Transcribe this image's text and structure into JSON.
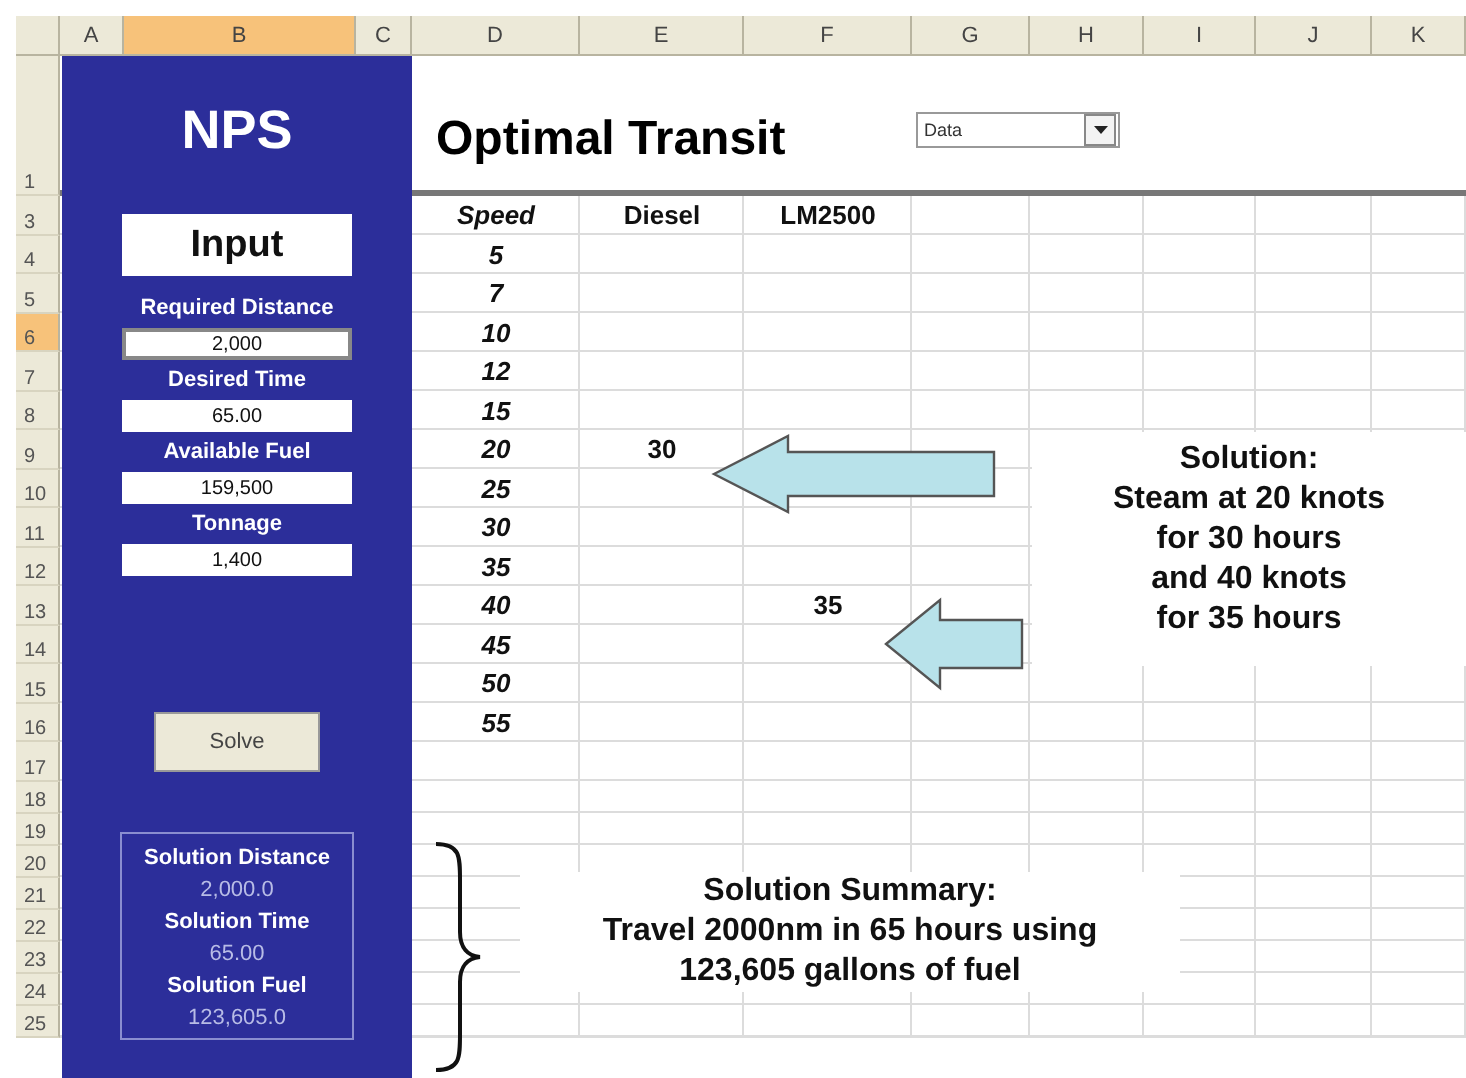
{
  "sheet": {
    "column_headers": [
      {
        "label": "A",
        "selected": false
      },
      {
        "label": "B",
        "selected": true
      },
      {
        "label": "C",
        "selected": false
      },
      {
        "label": "D",
        "selected": false
      },
      {
        "label": "E",
        "selected": false
      },
      {
        "label": "F",
        "selected": false
      },
      {
        "label": "G",
        "selected": false
      },
      {
        "label": "H",
        "selected": false
      },
      {
        "label": "I",
        "selected": false
      },
      {
        "label": "J",
        "selected": false
      },
      {
        "label": "K",
        "selected": false
      }
    ],
    "row_headers": [
      {
        "label": "1",
        "selected": false
      },
      {
        "label": "3",
        "selected": false
      },
      {
        "label": "4",
        "selected": false
      },
      {
        "label": "5",
        "selected": false
      },
      {
        "label": "6",
        "selected": true
      },
      {
        "label": "7",
        "selected": false
      },
      {
        "label": "8",
        "selected": false
      },
      {
        "label": "9",
        "selected": false
      },
      {
        "label": "10",
        "selected": false
      },
      {
        "label": "11",
        "selected": false
      },
      {
        "label": "12",
        "selected": false
      },
      {
        "label": "13",
        "selected": false
      },
      {
        "label": "14",
        "selected": false
      },
      {
        "label": "15",
        "selected": false
      },
      {
        "label": "16",
        "selected": false
      },
      {
        "label": "17",
        "selected": false
      },
      {
        "label": "18",
        "selected": false
      },
      {
        "label": "19",
        "selected": false
      },
      {
        "label": "20",
        "selected": false
      },
      {
        "label": "21",
        "selected": false
      },
      {
        "label": "22",
        "selected": false
      },
      {
        "label": "23",
        "selected": false
      },
      {
        "label": "24",
        "selected": false
      },
      {
        "label": "25",
        "selected": false
      }
    ]
  },
  "panel": {
    "title": "NPS",
    "section_label": "Input",
    "inputs": [
      {
        "label": "Required Distance",
        "value": "2,000",
        "selected": true
      },
      {
        "label": "Desired Time",
        "value": "65.00",
        "selected": false
      },
      {
        "label": "Available Fuel",
        "value": "159,500",
        "selected": false
      },
      {
        "label": "Tonnage",
        "value": "1,400",
        "selected": false
      }
    ],
    "button": "Solve",
    "summary": [
      {
        "label": "Solution Distance",
        "value": "2,000.0"
      },
      {
        "label": "Solution Time",
        "value": "65.00"
      },
      {
        "label": "Solution Fuel",
        "value": "123,605.0"
      }
    ]
  },
  "title": "Optimal Transit",
  "dropdown": {
    "value": "Data"
  },
  "table": {
    "columns": [
      "Speed",
      "Diesel",
      "LM2500"
    ],
    "rows": [
      {
        "speed": "5"
      },
      {
        "speed": "7"
      },
      {
        "speed": "10"
      },
      {
        "speed": "12"
      },
      {
        "speed": "15"
      },
      {
        "speed": "20",
        "diesel": "30"
      },
      {
        "speed": "25"
      },
      {
        "speed": "30"
      },
      {
        "speed": "35"
      },
      {
        "speed": "40",
        "lm2500": "35"
      },
      {
        "speed": "45"
      },
      {
        "speed": "50"
      },
      {
        "speed": "55"
      }
    ]
  },
  "callout": "Solution:\nSteam at 20 knots\nfor 30 hours\nand 40 knots\nfor 35 hours",
  "summary_note": "Solution Summary:\nTravel 2000nm  in 65 hours using\n123,605  gallons of fuel"
}
